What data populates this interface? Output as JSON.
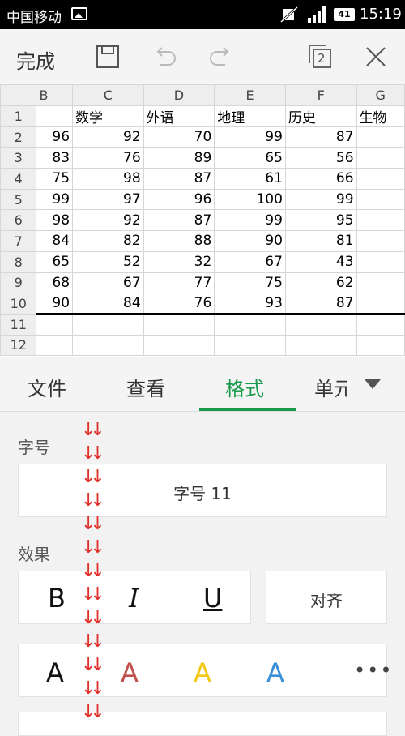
{
  "status_bar": {
    "carrier": "中国移动",
    "battery": "41",
    "time": "15:19"
  },
  "toolbar": {
    "done_label": "完成",
    "window_count": "2"
  },
  "sheet": {
    "col_headers": [
      "B",
      "C",
      "D",
      "E",
      "F",
      "G"
    ],
    "row_headers": [
      "1",
      "2",
      "3",
      "4",
      "5",
      "6",
      "7",
      "8",
      "9",
      "10",
      "11",
      "12"
    ],
    "rows": [
      [
        "",
        "数学",
        "外语",
        "地理",
        "历史",
        "生物"
      ],
      [
        "96",
        "92",
        "70",
        "99",
        "87",
        ""
      ],
      [
        "83",
        "76",
        "89",
        "65",
        "56",
        ""
      ],
      [
        "75",
        "98",
        "87",
        "61",
        "66",
        ""
      ],
      [
        "99",
        "97",
        "96",
        "100",
        "99",
        ""
      ],
      [
        "98",
        "92",
        "87",
        "99",
        "95",
        ""
      ],
      [
        "84",
        "82",
        "88",
        "90",
        "81",
        ""
      ],
      [
        "65",
        "52",
        "32",
        "67",
        "43",
        ""
      ],
      [
        "68",
        "67",
        "77",
        "75",
        "62",
        ""
      ],
      [
        "90",
        "84",
        "76",
        "93",
        "87",
        ""
      ],
      [
        "",
        "",
        "",
        "",
        "",
        ""
      ],
      [
        "",
        "",
        "",
        "",
        "",
        ""
      ]
    ]
  },
  "tabs": {
    "file": "文件",
    "view": "查看",
    "format": "格式",
    "cell": "单元"
  },
  "format_panel": {
    "font_size_label": "字号",
    "font_size_value": "字号  11",
    "effects_label": "效果",
    "bold": "B",
    "italic": "I",
    "underline": "U",
    "align": "对齐",
    "color_letter": "A",
    "more": "•••"
  },
  "colors": {
    "accent_green": "#1a9a4c",
    "font_black": "#111111",
    "font_red": "#c0504d",
    "font_yellow": "#f2c811",
    "font_blue": "#3a8fd6",
    "arrow_red": "#e0302a"
  }
}
